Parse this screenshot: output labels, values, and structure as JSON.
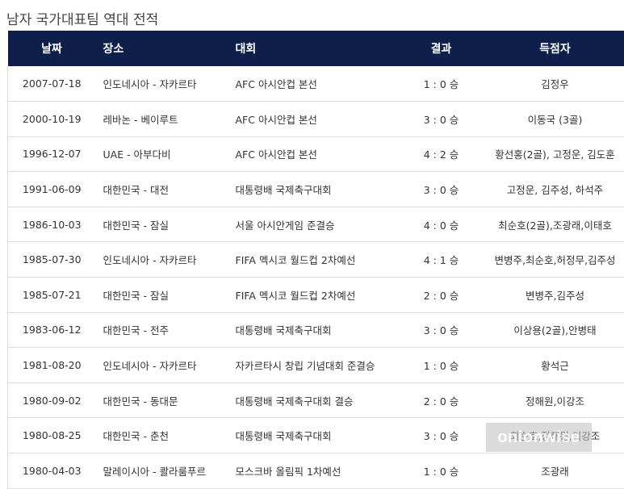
{
  "page": {
    "title": "남자 국가대표팀 역대 전적"
  },
  "table": {
    "headers": {
      "date": "날짜",
      "venue": "장소",
      "competition": "대회",
      "result": "결과",
      "scorers": "득점자"
    },
    "rows": [
      {
        "date": "2007-07-18",
        "venue": "인도네시아 - 자카르타",
        "competition": "AFC 아시안컵 본선",
        "result": "1 : 0 승",
        "scorers": "김정우"
      },
      {
        "date": "2000-10-19",
        "venue": "레바논 - 베이루트",
        "competition": "AFC 아시안컵 본선",
        "result": "3 : 0 승",
        "scorers": "이동국 (3골)"
      },
      {
        "date": "1996-12-07",
        "venue": "UAE - 아부다비",
        "competition": "AFC 아시안컵 본선",
        "result": "4 : 2 승",
        "scorers": "황선홍(2골), 고정운, 김도훈"
      },
      {
        "date": "1991-06-09",
        "venue": "대한민국 - 대전",
        "competition": "대통령배 국제축구대회",
        "result": "3 : 0 승",
        "scorers": "고정운, 김주성, 하석주"
      },
      {
        "date": "1986-10-03",
        "venue": "대한민국 - 잠실",
        "competition": "서울 아시안게임 준결승",
        "result": "4 : 0 승",
        "scorers": "최순호(2골),조광래,이태호"
      },
      {
        "date": "1985-07-30",
        "venue": "인도네시아 - 자카르타",
        "competition": "FIFA 멕시코 월드컵 2차예선",
        "result": "4 : 1 승",
        "scorers": "변병주,최순호,허정무,김주성"
      },
      {
        "date": "1985-07-21",
        "venue": "대한민국 - 잠실",
        "competition": "FIFA 멕시코 월드컵 2차예선",
        "result": "2 : 0 승",
        "scorers": "변병주,김주성"
      },
      {
        "date": "1983-06-12",
        "venue": "대한민국 - 전주",
        "competition": "대통령배 국제축구대회",
        "result": "3 : 0 승",
        "scorers": "이상용(2골),안병태"
      },
      {
        "date": "1981-08-20",
        "venue": "인도네시아 - 자카르타",
        "competition": "자카르타시 창립 기념대회 준결승",
        "result": "1 : 0 승",
        "scorers": "황석근"
      },
      {
        "date": "1980-09-02",
        "venue": "대한민국 - 동대문",
        "competition": "대통령배 국제축구대회 결승",
        "result": "2 : 0 승",
        "scorers": "정해원,이강조"
      },
      {
        "date": "1980-08-25",
        "venue": "대한민국 - 춘천",
        "competition": "대통령배 국제축구대회",
        "result": "3 : 0 승",
        "scorers": "최순호,정해원,이강조"
      },
      {
        "date": "1980-04-03",
        "venue": "말레이시아 - 콸라룸푸르",
        "competition": "모스크바 올림픽 1차예선",
        "result": "1 : 0 승",
        "scorers": "조광래"
      }
    ]
  },
  "watermark": {
    "text": "onionwise"
  },
  "colors": {
    "header_bg": "#0f1f4b",
    "header_text": "#ffffff",
    "row_border": "#dcdcdc"
  }
}
